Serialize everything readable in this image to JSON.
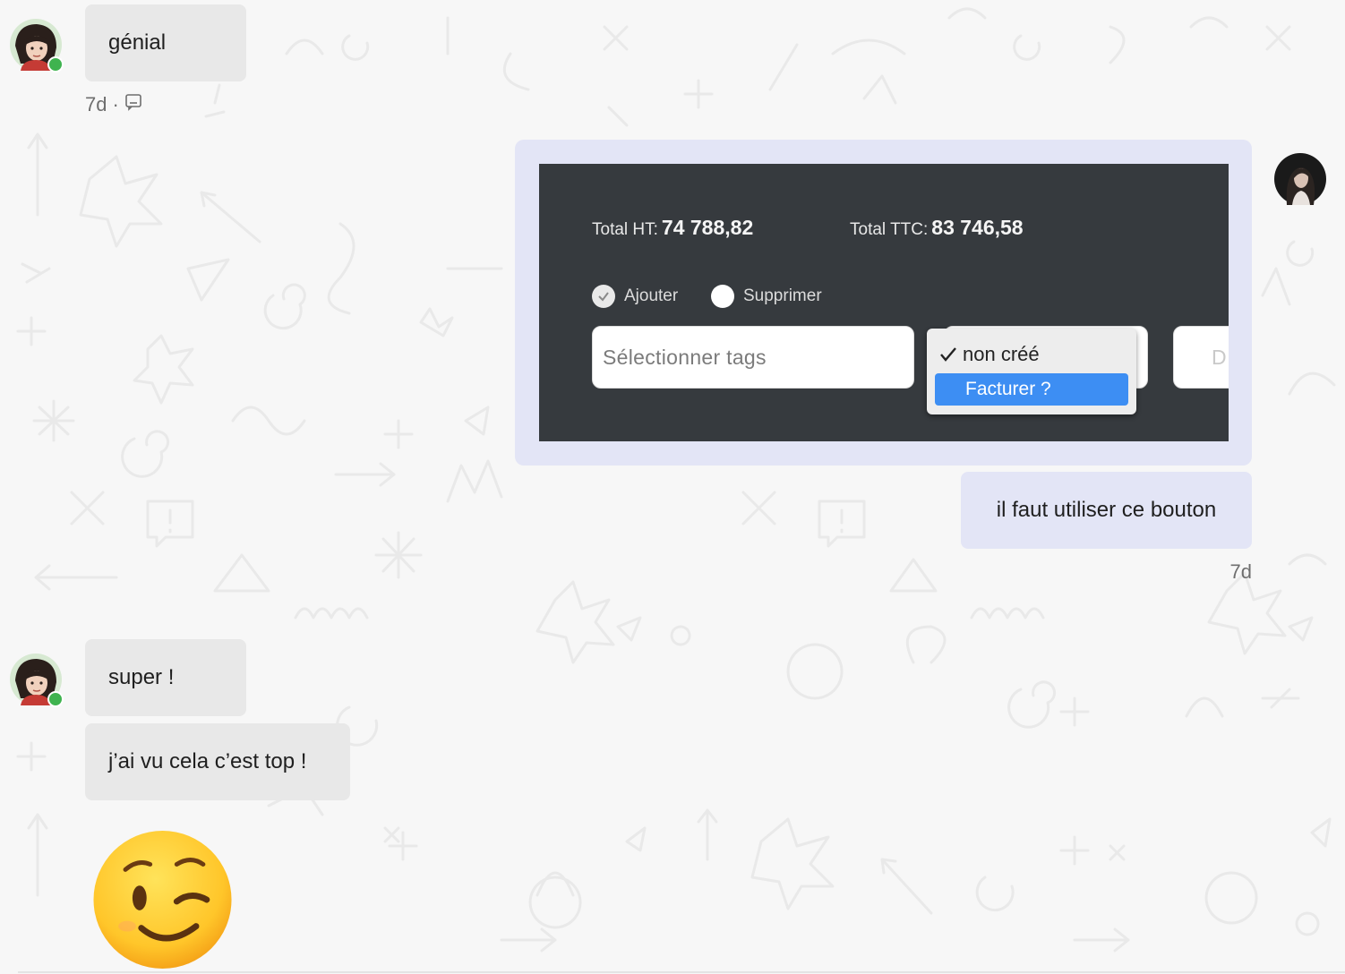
{
  "messages": [
    {
      "id": "m1",
      "direction": "incoming",
      "text": "génial",
      "time": "7d",
      "separator": "·",
      "read_icon": "read-receipt-icon"
    },
    {
      "id": "m2",
      "direction": "outgoing",
      "type": "image",
      "screenshot": {
        "total_ht_label": "Total HT:",
        "total_ht_value": "74 788,82",
        "total_ttc_label": "Total TTC:",
        "total_ttc_value": "83 746,58",
        "radio_add": "Ajouter",
        "radio_remove": "Supprimer",
        "tags_placeholder": "Sélectionner tags",
        "dropdown_option_checked": "non créé",
        "dropdown_option_highlighted": "Facturer ?",
        "cut_field_text": "D"
      }
    },
    {
      "id": "m3",
      "direction": "outgoing",
      "text": "il faut utiliser ce bouton",
      "time": "7d"
    },
    {
      "id": "m4",
      "direction": "incoming",
      "text": "super !"
    },
    {
      "id": "m5",
      "direction": "incoming",
      "text": "j’ai vu cela c’est top !"
    },
    {
      "id": "m6",
      "direction": "incoming",
      "type": "emoji",
      "emoji": "winking-face-emoji"
    }
  ],
  "colors": {
    "background": "#f7f7f7",
    "incoming_bubble": "#e8e8e8",
    "outgoing_bubble": "#e3e5f6",
    "online": "#3fb34f",
    "highlight": "#3d8ef3"
  }
}
